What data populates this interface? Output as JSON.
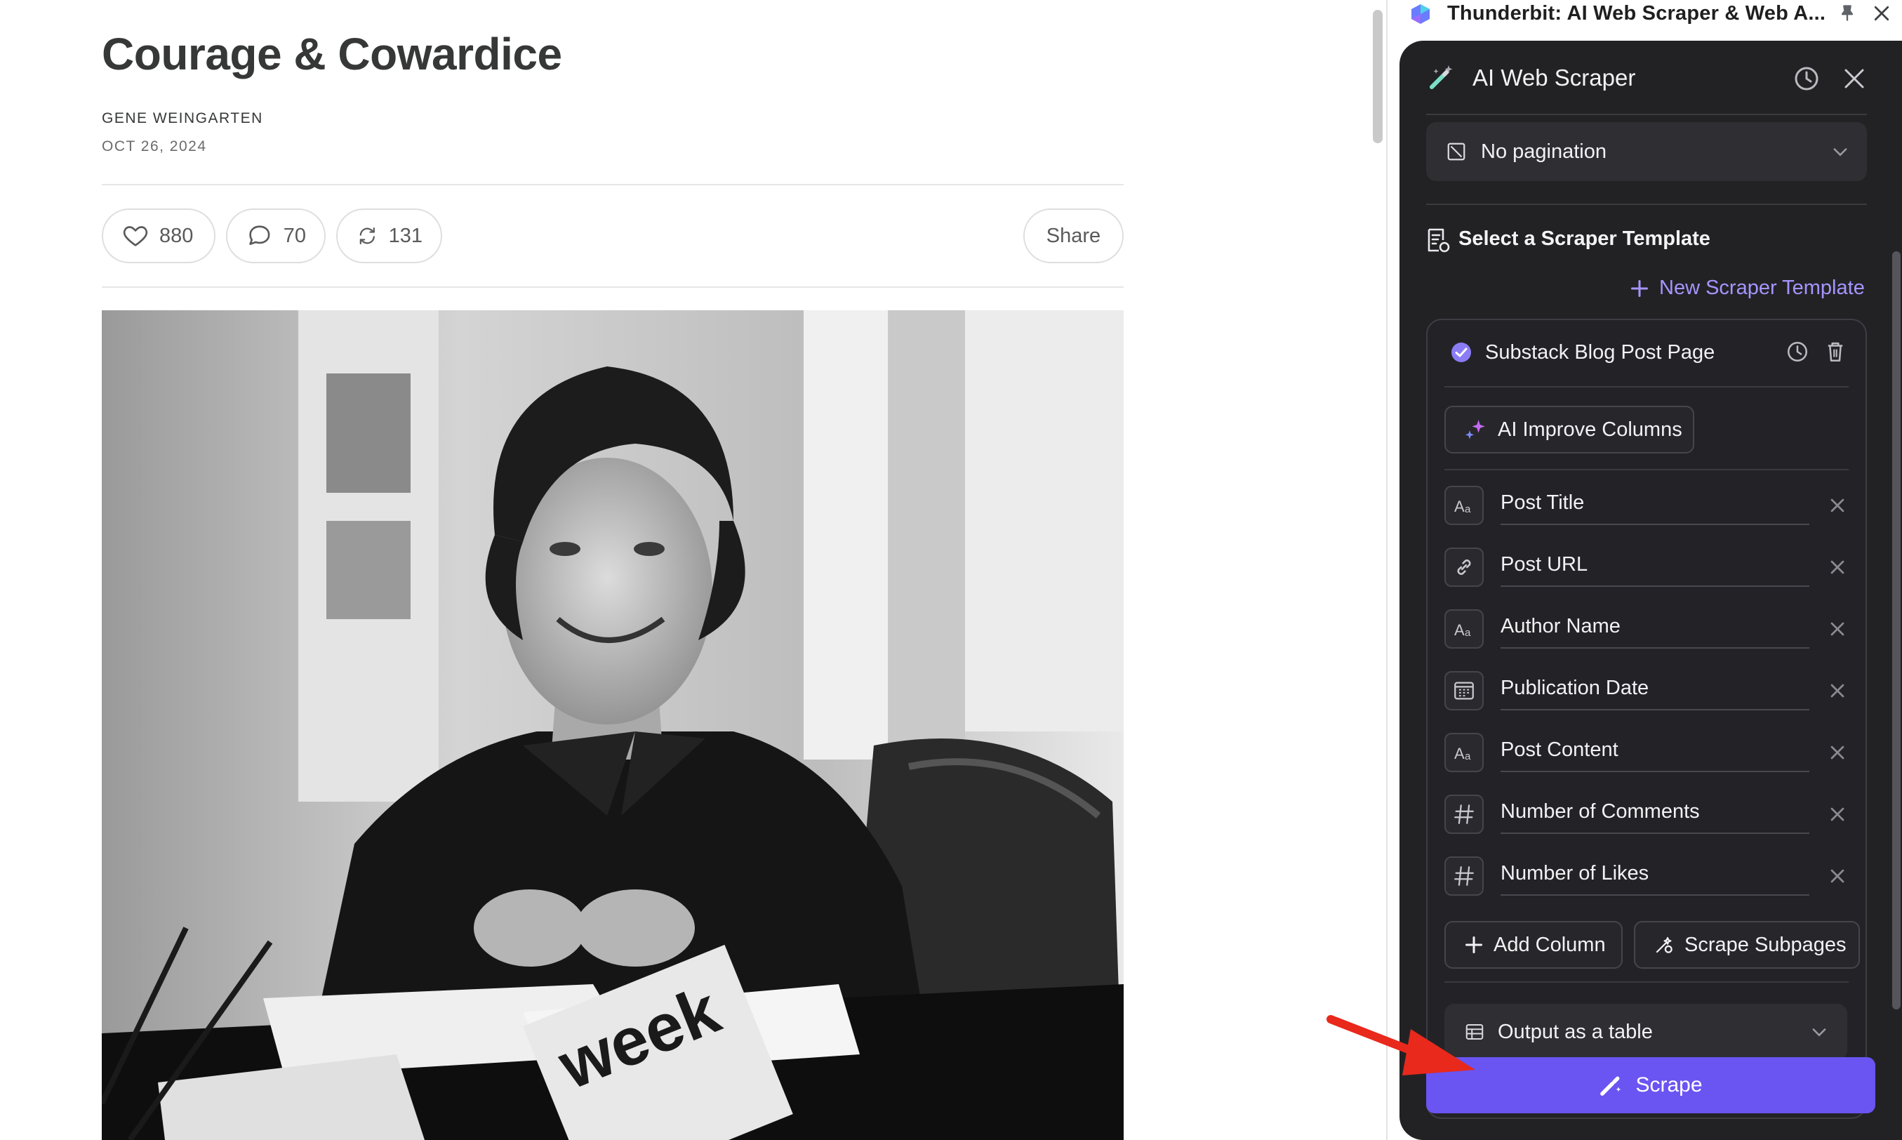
{
  "article": {
    "title": "Courage & Cowardice",
    "author": "GENE WEINGARTEN",
    "date": "OCT 26, 2024",
    "likes": "880",
    "comments": "70",
    "restacks": "131",
    "share_label": "Share",
    "image_text": "week"
  },
  "extension": {
    "tab_title": "Thunderbit: AI Web Scraper & Web A...",
    "panel_title": "AI Web Scraper",
    "pagination": "No pagination",
    "section_title": "Select a Scraper Template",
    "new_template": "New Scraper Template",
    "template_name": "Substack Blog Post Page",
    "ai_improve": "AI Improve Columns",
    "columns": [
      {
        "name": "Post Title",
        "type": "text-icon"
      },
      {
        "name": "Post URL",
        "type": "link-icon"
      },
      {
        "name": "Author Name",
        "type": "text-icon"
      },
      {
        "name": "Publication Date",
        "type": "calendar-icon"
      },
      {
        "name": "Post Content",
        "type": "text-icon"
      },
      {
        "name": "Number of Comments",
        "type": "hash-icon"
      },
      {
        "name": "Number of Likes",
        "type": "hash-icon"
      }
    ],
    "add_column": "Add Column",
    "scrape_subpages": "Scrape Subpages",
    "output": "Output as a table",
    "scrape": "Scrape"
  },
  "colors": {
    "panel_bg": "#222225",
    "accent": "#6a54f2",
    "accent_text": "#a595ff",
    "annotation_arrow": "#e8291c"
  }
}
